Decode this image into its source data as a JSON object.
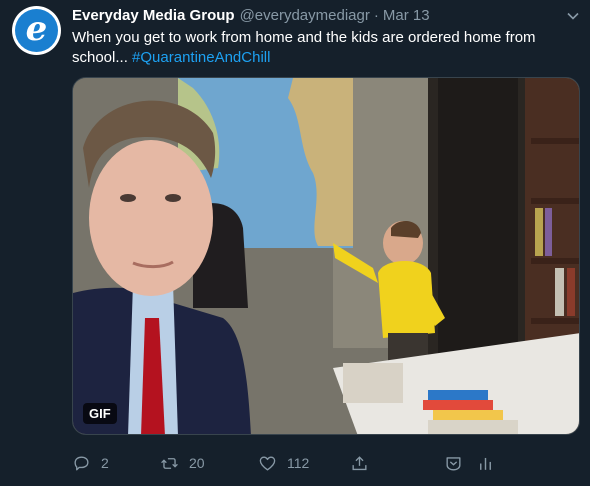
{
  "tweet": {
    "display_name": "Everyday Media Group",
    "handle": "@everydaymediagr",
    "separator": "·",
    "date": "Mar 13",
    "text_prefix": "When you get to work from home and the kids are ordered home from school... ",
    "hashtag": "#QuarantineAndChill",
    "avatar_letter": "e"
  },
  "media": {
    "badge": "GIF"
  },
  "actions": {
    "reply_count": "2",
    "retweet_count": "20",
    "like_count": "112"
  },
  "icons": {
    "avatar": "everyday-media-logo",
    "caret": "chevron-down-icon",
    "reply": "reply-icon",
    "retweet": "retweet-icon",
    "like": "heart-icon",
    "share": "share-icon",
    "dm": "messages-icon",
    "analytics": "analytics-icon"
  },
  "colors": {
    "background": "#15202b",
    "hashtag": "#1da1f2",
    "secondary_text": "#8899a6",
    "avatar": "#1a7fd0"
  }
}
